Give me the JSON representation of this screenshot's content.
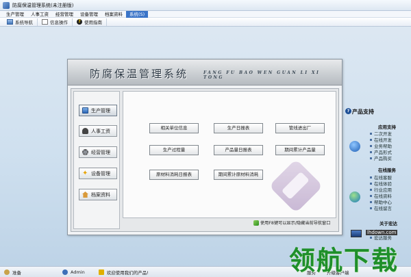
{
  "window": {
    "title": "防腐保温管理系统(未注册版)"
  },
  "menu": [
    "生产管理",
    "人事工资",
    "经营管理",
    "设备管理",
    "档案资料",
    "系统(S)"
  ],
  "toolbar": {
    "nav": "系统导航",
    "info": "信息操作",
    "help": "使用指南"
  },
  "panel": {
    "title": "防腐保温管理系统",
    "pinyin": "FANG FU BAO WEN GUAN LI XI TONG",
    "nav_items": [
      "生产管理",
      "人事工资",
      "经营管理",
      "设备管理",
      "档案资料"
    ],
    "buttons": [
      "相关单位信息",
      "生产日报表",
      "管线进出厂",
      "生产过程量",
      "产品量日报表",
      "期间累计产品量",
      "原材料消耗日报表",
      "期间累计原材料消耗"
    ],
    "hint": "使用F8键可以显示/隐藏当前导航窗口"
  },
  "sidebar": {
    "title": "产品支持",
    "sections": [
      {
        "label": "应用支持",
        "links": [
          "二次开发",
          "在线开发",
          "业务帮助",
          "产品形式",
          "产品购买"
        ]
      },
      {
        "label": "在线服务",
        "links": [
          "在线客服",
          "在线体验",
          "行业应用",
          "在线资料",
          "帮助中心",
          "在线留言"
        ]
      },
      {
        "label": "关于宏达",
        "links": [
          "宏达公司",
          "宏达服务"
        ]
      }
    ]
  },
  "status": {
    "ready": "准备",
    "user": "Admin",
    "welcome": "欢迎使用我们的产品!",
    "extra1": "服务",
    "extra2": "升级客户端"
  },
  "watermark": {
    "site": "lhdown.com",
    "brand": "领航下载"
  }
}
